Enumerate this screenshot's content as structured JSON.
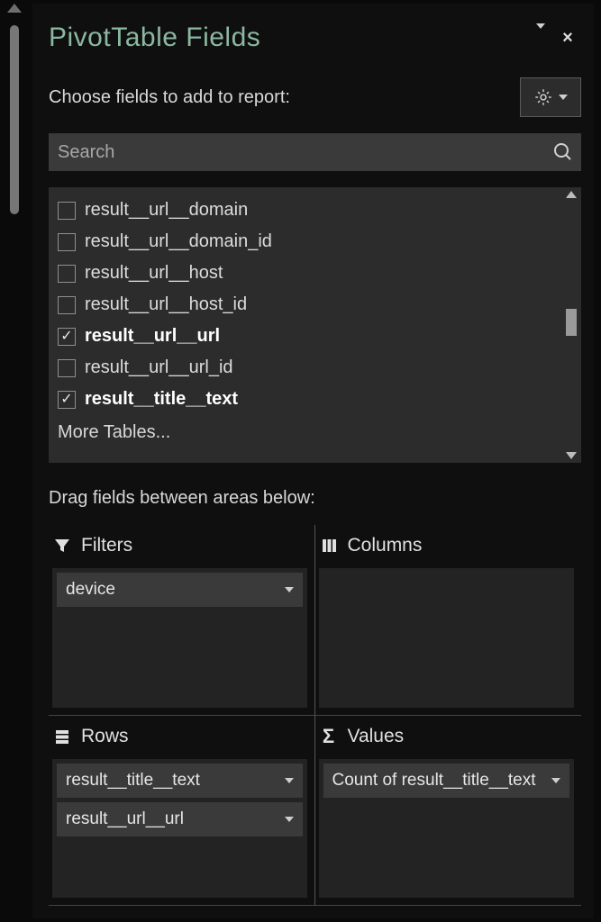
{
  "panel": {
    "title": "PivotTable Fields",
    "choose_label": "Choose fields to add to report:",
    "search_placeholder": "Search",
    "more_tables": "More Tables...",
    "drag_hint": "Drag fields between areas below:"
  },
  "fields": [
    {
      "name": "result__url__domain",
      "checked": false
    },
    {
      "name": "result__url__domain_id",
      "checked": false
    },
    {
      "name": "result__url__host",
      "checked": false
    },
    {
      "name": "result__url__host_id",
      "checked": false
    },
    {
      "name": "result__url__url",
      "checked": true
    },
    {
      "name": "result__url__url_id",
      "checked": false
    },
    {
      "name": "result__title__text",
      "checked": true
    }
  ],
  "areas": {
    "filters": {
      "title": "Filters",
      "items": [
        "device"
      ]
    },
    "columns": {
      "title": "Columns",
      "items": []
    },
    "rows": {
      "title": "Rows",
      "items": [
        "result__title__text",
        "result__url__url"
      ]
    },
    "values": {
      "title": "Values",
      "items": [
        "Count of result__title__text"
      ]
    }
  }
}
